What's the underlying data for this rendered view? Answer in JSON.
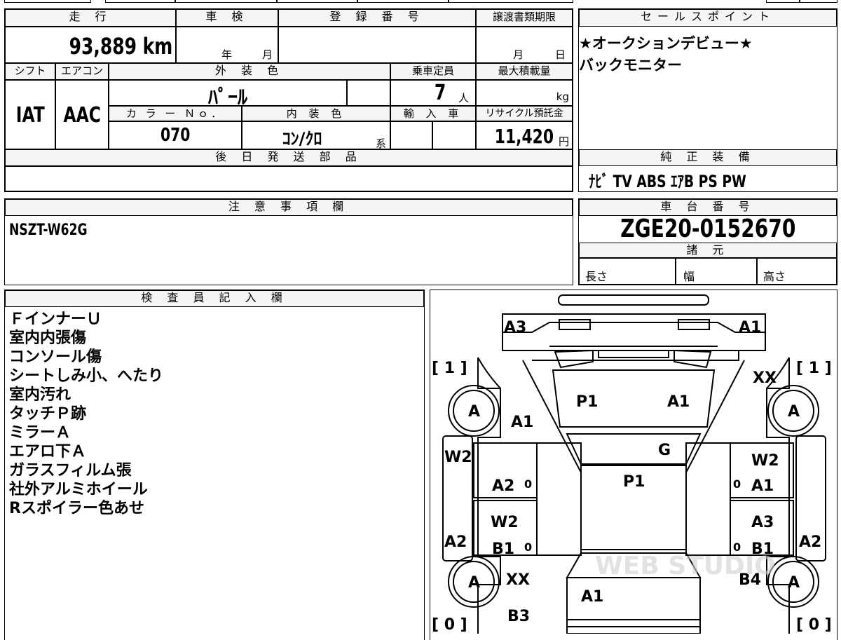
{
  "top_info": {
    "mileage_label": "走 行",
    "mileage_value": "93,889 km",
    "shaken_label": "車 検",
    "shaken_year": "年",
    "shaken_month": "月",
    "reg_label": "登 録 番 号",
    "transfer_label": "譲渡書類期限",
    "transfer_month": "月",
    "transfer_day": "日",
    "shift_label": "シフト",
    "shift_value": "IAT",
    "ac_label": "エアコン",
    "ac_value": "AAC",
    "ext_color_label": "外 装 色",
    "ext_color_value": "ﾊﾟｰﾙ",
    "capacity_label": "乗車定員",
    "capacity_value": "7",
    "capacity_unit": "人",
    "max_load_label": "最大積載量",
    "max_load_unit": "kg",
    "color_no_label": "カ ラ ー Ｎｏ．",
    "color_no_value": "070",
    "int_color_label": "内 装 色",
    "int_color_value": "ｺﾝ/ｸﾛ",
    "int_color_suffix": "系",
    "import_label": "輸 入 車",
    "recycle_label": "リサイクル預託金",
    "recycle_value": "11,420",
    "recycle_unit": "円",
    "later_parts_label": "後 日 発 送 部 品"
  },
  "sales_point": {
    "label": "セールスポイント",
    "lines": [
      "★オークションデビュー★",
      "バックモニター"
    ]
  },
  "equipment": {
    "label": "純 正 装 備",
    "value": "ﾅﾋﾞ  TV  ABS  ｴｱB  PS  PW"
  },
  "caution": {
    "label": "注 意 事 項 欄",
    "value": "NSZT-W62G"
  },
  "chassis": {
    "label": "車 台 番 号",
    "value": "ZGE20-0152670",
    "spec_label": "諸 元",
    "length_label": "長さ",
    "width_label": "幅",
    "height_label": "高さ"
  },
  "inspector": {
    "label": "検 査 員 記 入 欄",
    "lines": [
      "ＦインナーＵ",
      "室内内張傷",
      "コンソール傷",
      "シートしみ小、へたり",
      "室内汚れ",
      "タッチＰ跡",
      "ミラーＡ",
      "エアロ下Ａ",
      "ガラスフィルム張",
      "社外アルミホイール",
      "Rスポイラー色あせ"
    ]
  },
  "diagram": {
    "marks": {
      "front_left": "A3",
      "front_right": "A1",
      "front_left_bracket": "[ 1 ]",
      "front_right_bracket": "[ 1 ]",
      "front_right_xx": "XX",
      "tire_fl": "A",
      "tire_fr": "A",
      "tire_rl": "A",
      "tire_rr": "A",
      "fender_left": "A1",
      "windshield_left": "P1",
      "windshield_right": "A1",
      "glass_g": "G",
      "roof": "P1",
      "left_w2_top": "W2",
      "right_w2_top": "W2",
      "left_door_front": "A2",
      "left_door_front_zero": "0",
      "right_door_front": "A1",
      "right_door_front_zero": "0",
      "left_door_rear_w2": "W2",
      "left_door_rear": "B1",
      "left_door_rear_zero": "0",
      "right_door_rear_a3": "A3",
      "right_door_rear": "B1",
      "right_door_rear_zero": "0",
      "left_side_a2": "A2",
      "right_side_a2": "A2",
      "left_rear_xx": "XX",
      "right_rear_b4": "B4",
      "trunk": "A1",
      "rear_left_bracket": "[ 0 ]",
      "rear_right_bracket": "[ 0 ]",
      "rear_bumper": "B3",
      "watermark": "WEB STUDIO"
    }
  }
}
